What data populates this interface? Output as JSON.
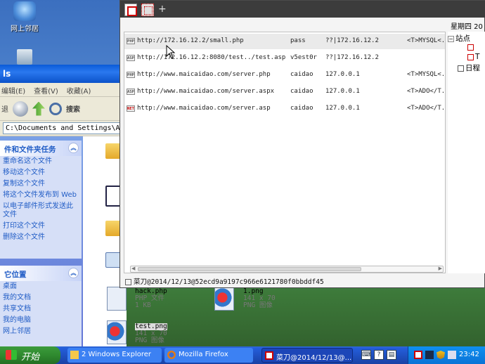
{
  "desktop": {
    "icons": [
      {
        "label": "网上邻居",
        "icon": "network-places-icon"
      },
      {
        "label": "",
        "icon": "recycle-bin-icon"
      }
    ]
  },
  "explorer": {
    "title_fragment": "ls",
    "menu": [
      "编辑(E)",
      "查看(V)",
      "收藏(A)"
    ],
    "toolbar": {
      "back": "退",
      "search": "搜索"
    },
    "address": "C:\\Documents and Settings\\Ad",
    "tasks": {
      "header": "件和文件夹任务",
      "items": [
        "重命名这个文件",
        "移动这个文件",
        "复制这个文件",
        "将这个文件发布到 Web",
        "以电子邮件形式发送此文件",
        "打印这个文件",
        "删除这个文件"
      ]
    },
    "places": {
      "header": "它位置",
      "items": [
        "桌面",
        "我的文档",
        "共享文档",
        "我的电脑",
        "网上邻居"
      ]
    },
    "files": [
      {
        "name": "hack.php",
        "type": "PHP 文件",
        "size": "1 KB"
      },
      {
        "name": "1.png",
        "type": "141 x 70",
        "size": "PNG 图像"
      },
      {
        "name": "test.png",
        "type": "141 x 70",
        "size": "PNG 图像"
      }
    ]
  },
  "caidao": {
    "date": "星期四 20",
    "rows": [
      {
        "badge": "PHP",
        "url": "http://172.16.12.2/small.php",
        "password": "pass",
        "ip": "??|172.16.12.2",
        "config": "<T>MYSQL<.."
      },
      {
        "badge": "ASP",
        "url": "http://172.16.12.2:8080/test../test.asp",
        "password": "v5est0r",
        "ip": "??|172.16.12.2",
        "config": ""
      },
      {
        "badge": "PHP",
        "url": "http://www.maicaidao.com/server.php",
        "password": "caidao",
        "ip": "127.0.0.1",
        "config": "<T>MYSQL<.."
      },
      {
        "badge": "ASP",
        "url": "http://www.maicaidao.com/server.aspx",
        "password": "caidao",
        "ip": "127.0.0.1",
        "config": "<T>ADO</T.."
      },
      {
        "badge": "NET",
        "url": "http://www.maicaidao.com/server.asp",
        "password": "caidao",
        "ip": "127.0.0.1",
        "config": "<T>ADO</T.."
      }
    ],
    "tree": [
      {
        "label": "站点",
        "toggle": "−"
      },
      {
        "label": "",
        "toggle": ""
      },
      {
        "label": "T",
        "toggle": ""
      },
      {
        "label": "日程",
        "toggle": ""
      }
    ],
    "status": "菜刀@2014/12/13@52ecd9a9197c966e6121780f0bbddf45"
  },
  "taskbar": {
    "start": "开始",
    "buttons": [
      {
        "label": "2 Windows Explorer"
      },
      {
        "label": "Mozilla Firefox"
      },
      {
        "label": "菜刀@2014/12/13@..."
      }
    ],
    "clock": "23:42"
  },
  "colors": {
    "taskbar": "#245edb",
    "start": "#2f8a2f",
    "task_pane": "#6375d6",
    "link": "#215dc6"
  }
}
